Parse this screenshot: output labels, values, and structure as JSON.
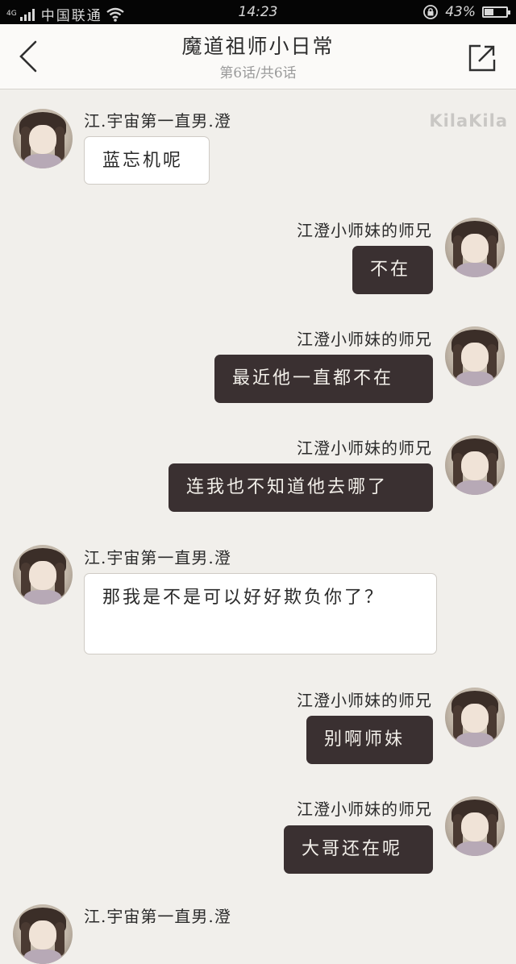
{
  "status_bar": {
    "network": "4G",
    "carrier": "中国联通",
    "time": "14:23",
    "battery": "43%",
    "battery_level": 0.43
  },
  "header": {
    "title": "魔道祖师小日常",
    "subtitle": "第6话/共6话"
  },
  "watermark": "KilaKila",
  "messages": [
    {
      "side": "left",
      "name": "江.宇宙第一直男.澄",
      "text": "蓝忘机呢"
    },
    {
      "side": "right",
      "name": "江澄小师妹的师兄",
      "text": "不在"
    },
    {
      "side": "right",
      "name": "江澄小师妹的师兄",
      "text": "最近他一直都不在"
    },
    {
      "side": "right",
      "name": "江澄小师妹的师兄",
      "text": "连我也不知道他去哪了"
    },
    {
      "side": "left",
      "name": "江.宇宙第一直男.澄",
      "text": "那我是不是可以好好欺负你了？"
    },
    {
      "side": "right",
      "name": "江澄小师妹的师兄",
      "text": "别啊师妹"
    },
    {
      "side": "right",
      "name": "江澄小师妹的师兄",
      "text": "大哥还在呢"
    },
    {
      "side": "left",
      "name": "江.宇宙第一直男.澄",
      "text": ""
    }
  ]
}
